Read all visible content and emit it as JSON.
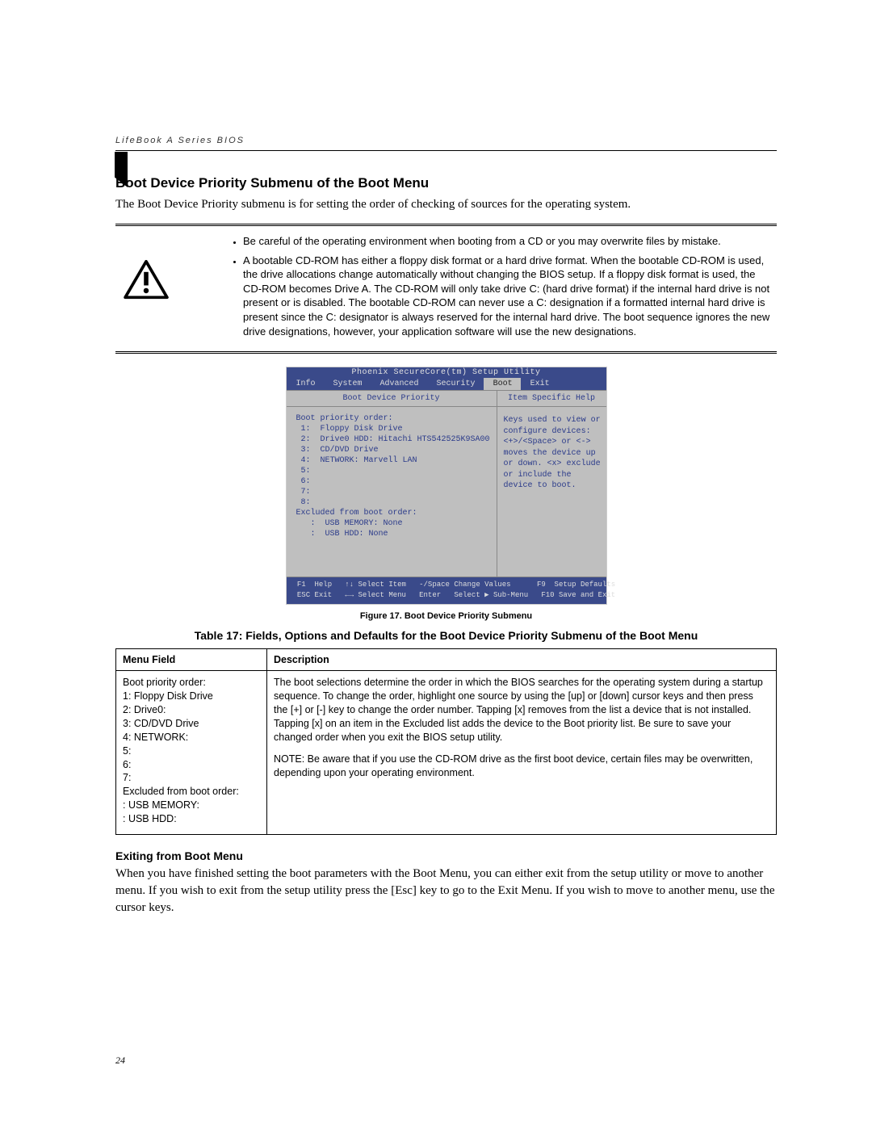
{
  "header": {
    "running_title": "LifeBook A Series BIOS"
  },
  "section": {
    "title": "Boot Device Priority Submenu of the Boot Menu",
    "intro": "The Boot Device Priority submenu is for setting the order of checking of sources for the operating system."
  },
  "warning": {
    "bullet1": "Be careful of the operating environment when booting from a CD or you may overwrite files by mistake.",
    "bullet2": "A bootable CD-ROM has either a floppy disk format or a hard drive format. When the bootable CD-ROM is used, the drive allocations change automatically without changing the BIOS setup. If a floppy disk format is used, the CD-ROM becomes Drive A. The CD-ROM will only take drive C: (hard drive format) if the internal hard drive is not present or is disabled. The bootable CD-ROM can never use a C: designation if a formatted internal hard drive is present since the C: designator is always reserved for the internal hard drive. The boot sequence ignores the new drive designations, however, your application software will use the new designations."
  },
  "bios": {
    "title": "Phoenix SecureCore(tm) Setup Utility",
    "tabs": [
      "Info",
      "System",
      "Advanced",
      "Security",
      "Boot",
      "Exit"
    ],
    "active_tab": "Boot",
    "left_title": "Boot Device Priority",
    "right_title": "Item Specific Help",
    "priority_order_label": "Boot priority order:",
    "priority_order": [
      "Floppy Disk Drive",
      "Drive0 HDD: Hitachi HTS542525K9SA00",
      "CD/DVD Drive",
      "NETWORK: Marvell LAN",
      "",
      "",
      "",
      ""
    ],
    "excluded_label": "Excluded from boot order:",
    "excluded": [
      "USB MEMORY: None",
      "USB HDD: None"
    ],
    "help_lines": [
      "Keys used to view or",
      "configure devices:",
      "",
      "<+>/<Space> or <->",
      "moves the device up or",
      "down.",
      "<x> exclude or include",
      "the device to boot."
    ],
    "footer": {
      "f1": "F1",
      "help": "Help",
      "updown": "↑↓",
      "select_item": "Select Item",
      "minus_space": "-/Space",
      "change_values": "Change Values",
      "f9": "F9",
      "setup_defaults": "Setup Defaults",
      "esc": "ESC",
      "exit": "Exit",
      "leftright": "←→",
      "select_menu": "Select Menu",
      "enter": "Enter",
      "select_sub": "Select ▶ Sub-Menu",
      "f10": "F10",
      "save_exit": "Save and Exit"
    }
  },
  "figure_caption": "Figure 17.  Boot Device Priority Submenu",
  "table": {
    "title": "Table 17: Fields, Options and Defaults for the Boot Device Priority Submenu of the Boot Menu",
    "headers": {
      "col1": "Menu Field",
      "col2": "Description"
    },
    "row": {
      "menu_field": "Boot priority order:\n  1: Floppy Disk Drive\n  2: Drive0:\n  3: CD/DVD Drive\n  4: NETWORK:\n  5:\n  6:\n  7:\nExcluded from boot order:\n   : USB MEMORY:\n   : USB HDD:",
      "description_main": "The boot selections determine the order in which the BIOS searches for the operating system during a startup sequence. To change the order, highlight one source by using the [up] or [down] cursor keys and then press the [+] or [-] key to change the order number. Tapping [x] removes from the list a device that is not installed. Tapping [x] on an item in the Excluded list adds the device to the Boot priority list. Be sure to save your changed order when you exit the BIOS setup utility.",
      "description_note": "NOTE: Be aware that if you use the CD-ROM drive as the first boot device, certain files may be overwritten, depending upon your operating environment."
    }
  },
  "exiting": {
    "title": "Exiting from Boot Menu",
    "body": "When you have finished setting the boot parameters with the Boot Menu, you can either exit from the setup utility or move to another menu. If you wish to exit from the setup utility press the [Esc] key to go to the Exit Menu. If you wish to move to another menu, use the cursor keys."
  },
  "page_number": "24"
}
